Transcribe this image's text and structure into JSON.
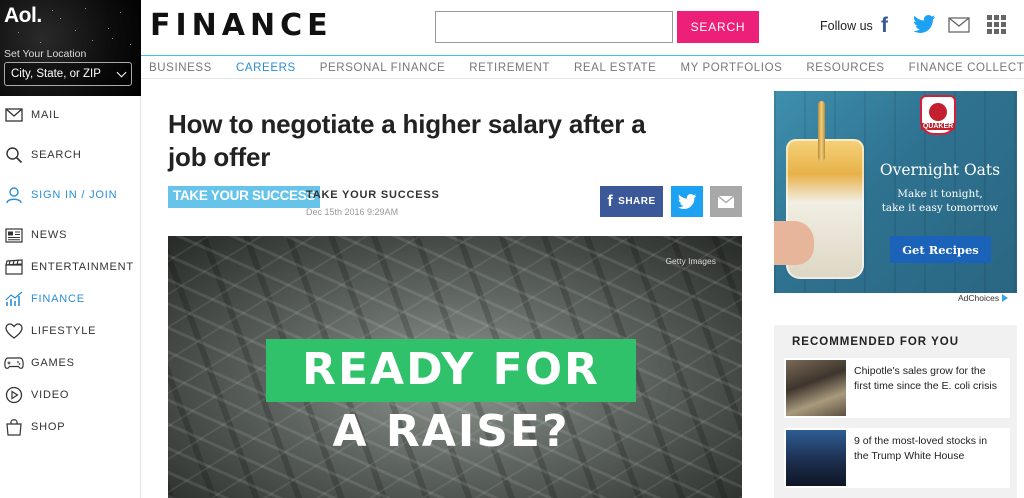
{
  "brand": {
    "logo": "Aol.",
    "location_label": "Set Your Location",
    "location_value": "City, State, or ZIP"
  },
  "sidebar": {
    "items": [
      {
        "label": "MAIL",
        "icon": "mail-icon"
      },
      {
        "label": "SEARCH",
        "icon": "search-icon"
      },
      {
        "label": "SIGN IN / JOIN",
        "icon": "user-icon"
      },
      {
        "label": "NEWS",
        "icon": "newspaper-icon"
      },
      {
        "label": "ENTERTAINMENT",
        "icon": "clapperboard-icon"
      },
      {
        "label": "FINANCE",
        "icon": "chart-icon"
      },
      {
        "label": "LIFESTYLE",
        "icon": "heart-icon"
      },
      {
        "label": "GAMES",
        "icon": "gamepad-icon"
      },
      {
        "label": "VIDEO",
        "icon": "play-icon"
      },
      {
        "label": "SHOP",
        "icon": "shopping-bag-icon"
      }
    ]
  },
  "header": {
    "title": "FINANCE",
    "search_button": "SEARCH",
    "search_value": "",
    "follow_label": "Follow us"
  },
  "subnav": {
    "items": [
      "BUSINESS",
      "CAREERS",
      "PERSONAL FINANCE",
      "RETIREMENT",
      "REAL ESTATE",
      "MY PORTFOLIOS",
      "RESOURCES",
      "FINANCE COLLECTIVE"
    ],
    "active": "CAREERS"
  },
  "article": {
    "headline": "How to negotiate a higher salary after a job offer",
    "tag": "TAKE YOUR SUCCESS",
    "brand": "TAKE YOUR SUCCESS",
    "date": "Dec 15th 2016 9:29AM",
    "share_label": "SHARE",
    "image": {
      "credit": "Getty Images",
      "line1": "READY FOR",
      "line2": "A RAISE?"
    }
  },
  "ad": {
    "logo_text": "QUAKER",
    "title": "Overnight Oats",
    "subtitle_line1": "Make it tonight,",
    "subtitle_line2": "take it easy tomorrow",
    "cta": "Get Recipes",
    "adchoices": "AdChoices"
  },
  "recommended": {
    "heading": "RECOMMENDED FOR YOU",
    "items": [
      {
        "text": "Chipotle's sales grow for the first time since the E. coli crisis"
      },
      {
        "text": "9 of the most-loved stocks in the Trump White House"
      }
    ]
  },
  "colors": {
    "accent_blue": "#2b8fd6",
    "search_pink": "#ec1f79",
    "facebook": "#3b5998",
    "twitter": "#1da1f2",
    "tag_blue": "#66c4ea",
    "hero_green": "#2fc26a"
  }
}
